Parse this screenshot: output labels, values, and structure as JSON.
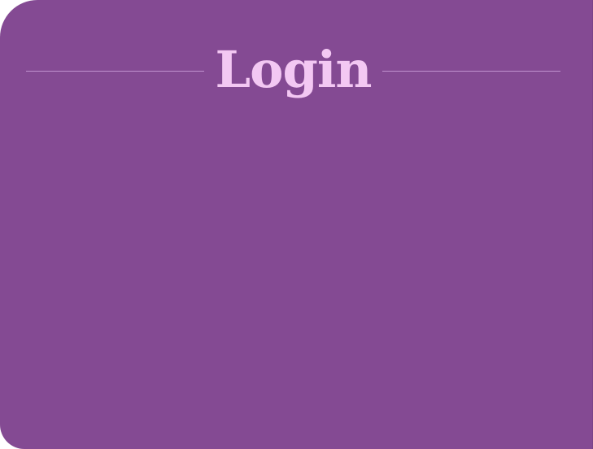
{
  "dialog": {
    "title": "Login"
  },
  "colors": {
    "panel_background": "#844a93",
    "title_text": "#f3c8f3",
    "divider": "#c79ad6"
  }
}
